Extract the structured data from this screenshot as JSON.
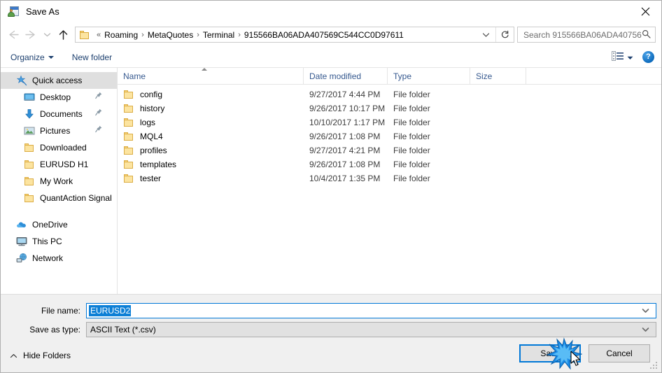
{
  "window": {
    "title": "Save As",
    "title_icon": "save-as-icon",
    "close_icon": "close-icon"
  },
  "nav": {
    "back_icon": "back-arrow-icon",
    "forward_icon": "forward-arrow-icon",
    "recent_icon": "chevron-down-icon",
    "up_icon": "up-arrow-icon",
    "refresh_icon": "refresh-icon",
    "breadcrumb": {
      "folder_icon": "folder-icon",
      "leading_sep": "«",
      "items": [
        "Roaming",
        "MetaQuotes",
        "Terminal",
        "915566BA06ADA407569C544CC0D97611"
      ],
      "separator": "›",
      "dropdown_icon": "chevron-down-icon"
    },
    "search": {
      "placeholder": "Search 915566BA06ADA40756...",
      "icon": "search-icon"
    }
  },
  "toolbar": {
    "organize_label": "Organize",
    "organize_icon": "caret-down-icon",
    "new_folder_label": "New folder",
    "view_icon": "view-layout-icon",
    "view_caret_icon": "caret-down-icon",
    "help_label": "?",
    "help_icon": "help-icon"
  },
  "sidebar": {
    "items": [
      {
        "label": "Quick access",
        "icon": "star-pin-icon",
        "selected": true,
        "level": 1,
        "pinned": false
      },
      {
        "label": "Desktop",
        "icon": "desktop-icon",
        "selected": false,
        "level": 2,
        "pinned": true
      },
      {
        "label": "Documents",
        "icon": "documents-icon",
        "selected": false,
        "level": 2,
        "pinned": true
      },
      {
        "label": "Pictures",
        "icon": "pictures-icon",
        "selected": false,
        "level": 2,
        "pinned": true
      },
      {
        "label": "Downloaded",
        "icon": "folder-icon",
        "selected": false,
        "level": 2,
        "pinned": false
      },
      {
        "label": "EURUSD H1",
        "icon": "folder-icon",
        "selected": false,
        "level": 2,
        "pinned": false
      },
      {
        "label": "My Work",
        "icon": "folder-icon",
        "selected": false,
        "level": 2,
        "pinned": false
      },
      {
        "label": "QuantAction Signal",
        "icon": "folder-icon",
        "selected": false,
        "level": 2,
        "pinned": false
      },
      {
        "label": "OneDrive",
        "icon": "onedrive-icon",
        "selected": false,
        "level": 1,
        "pinned": false
      },
      {
        "label": "This PC",
        "icon": "this-pc-icon",
        "selected": false,
        "level": 1,
        "pinned": false
      },
      {
        "label": "Network",
        "icon": "network-icon",
        "selected": false,
        "level": 1,
        "pinned": false
      }
    ]
  },
  "filelist": {
    "columns": [
      "Name",
      "Date modified",
      "Type",
      "Size"
    ],
    "sort_column": "Name",
    "sort_direction": "ascending",
    "rows": [
      {
        "name": "config",
        "date": "9/27/2017 4:44 PM",
        "type": "File folder",
        "size": ""
      },
      {
        "name": "history",
        "date": "9/26/2017 10:17 PM",
        "type": "File folder",
        "size": ""
      },
      {
        "name": "logs",
        "date": "10/10/2017 1:17 PM",
        "type": "File folder",
        "size": ""
      },
      {
        "name": "MQL4",
        "date": "9/26/2017 1:08 PM",
        "type": "File folder",
        "size": ""
      },
      {
        "name": "profiles",
        "date": "9/27/2017 4:21 PM",
        "type": "File folder",
        "size": ""
      },
      {
        "name": "templates",
        "date": "9/26/2017 1:08 PM",
        "type": "File folder",
        "size": ""
      },
      {
        "name": "tester",
        "date": "10/4/2017 1:35 PM",
        "type": "File folder",
        "size": ""
      }
    ]
  },
  "footer": {
    "file_name_label": "File name:",
    "file_name_value": "EURUSD2",
    "file_name_selected": true,
    "save_as_type_label": "Save as type:",
    "save_as_type_value": "ASCII Text (*.csv)",
    "hide_folders_label": "Hide Folders",
    "hide_folders_icon": "chevron-up-icon",
    "save_label": "Save",
    "cancel_label": "Cancel",
    "dropdown_icon": "chevron-down-icon",
    "resize_grip_icon": "resize-grip-icon"
  },
  "pointer": {
    "cursor_icon": "mouse-cursor-icon",
    "click_effect_icon": "click-burst-icon",
    "target": "Save"
  },
  "colors": {
    "accent": "#0078d7",
    "selection": "#0c7fd6",
    "header_text": "#36598f",
    "folder": "#fce4a0",
    "chrome": "#f0f0f0"
  }
}
